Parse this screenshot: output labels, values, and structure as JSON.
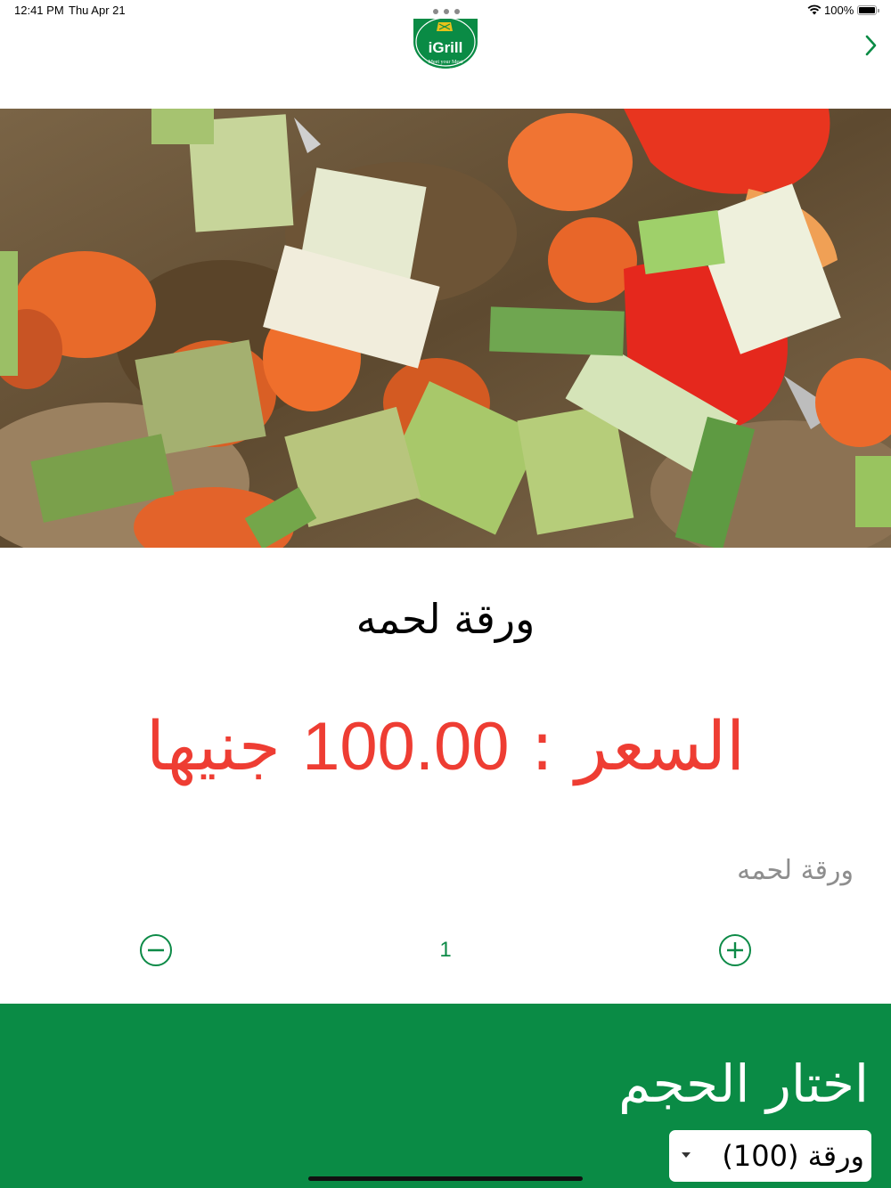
{
  "status_bar": {
    "time": "12:41 PM",
    "date": "Thu Apr 21",
    "battery": "100%"
  },
  "header": {
    "logo_text": "iGrill",
    "logo_tagline": "Meet your Meat",
    "brand_color": "#0a8b45"
  },
  "product": {
    "title": "ورقة لحمه",
    "price_label": "السعر :",
    "price_value": "100.00",
    "price_currency": "جنيها",
    "description": "ورقة لحمه",
    "price_color": "#ee3d33"
  },
  "quantity": {
    "value": "1"
  },
  "size": {
    "heading": "اختار الحجم",
    "selected": "ورقة    (100)"
  },
  "icons": [
    "wifi-icon",
    "battery-icon",
    "chevron-right-icon",
    "minus-circle-icon",
    "plus-circle-icon",
    "dropdown-caret-icon"
  ]
}
